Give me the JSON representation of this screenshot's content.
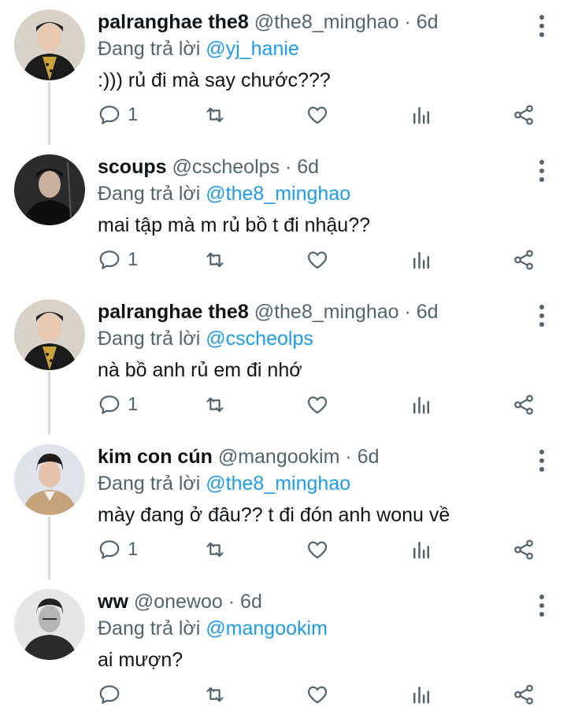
{
  "reply_prefix": "Đang trả lời",
  "tweets": [
    {
      "name": "palranghae the8",
      "handle": "@the8_minghao",
      "separator": "·",
      "time": "6d",
      "reply_to": "@yj_hanie",
      "text": ":))) rủ đi mà say chước???",
      "reply_count": "1",
      "avatar": "portrait-gold-jacket"
    },
    {
      "name": "scoups",
      "handle": "@cscheolps",
      "separator": "·",
      "time": "6d",
      "reply_to": "@the8_minghao",
      "text": "mai tập mà m rủ bồ t đi nhậu??",
      "reply_count": "1",
      "avatar": "portrait-dark"
    },
    {
      "name": "palranghae the8",
      "handle": "@the8_minghao",
      "separator": "·",
      "time": "6d",
      "reply_to": "@cscheolps",
      "text": "nà bồ anh rủ em đi nhớ",
      "reply_count": "1",
      "avatar": "portrait-gold-jacket"
    },
    {
      "name": "kim con cún",
      "handle": "@mangookim",
      "separator": "·",
      "time": "6d",
      "reply_to": "@the8_minghao",
      "text": "mày đang ở đâu?? t đi đón anh wonu về",
      "reply_count": "1",
      "avatar": "portrait-light"
    },
    {
      "name": "ww",
      "handle": "@onewoo",
      "separator": "·",
      "time": "6d",
      "reply_to": "@mangookim",
      "text": "ai mượn?",
      "reply_count": "",
      "avatar": "portrait-bw"
    }
  ],
  "colors": {
    "accent": "#1d9bf0",
    "secondary_text": "#536471",
    "thread_line": "#cfd9de"
  }
}
